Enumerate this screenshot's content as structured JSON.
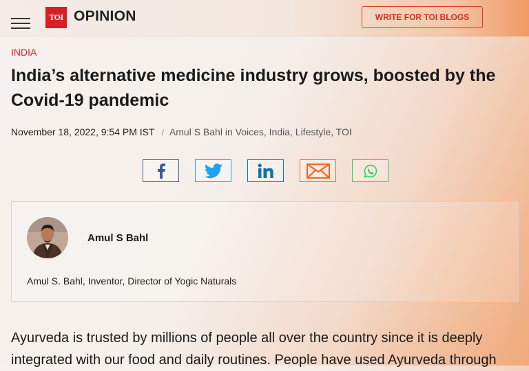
{
  "header": {
    "logo_text": "TOI",
    "section_title": "OPINION",
    "write_button": "WRITE FOR TOI BLOGS"
  },
  "article": {
    "category": "INDIA",
    "headline": "India’s alternative medicine industry grows, boosted by the Covid-19 pandemic",
    "datetime": "November 18, 2022, 9:54 PM IST",
    "separator": "/",
    "byline": "Amul S Bahl in Voices, India, Lifestyle, TOI",
    "body": "Ayurveda is trusted by millions of people all over the country since it is deeply integrated with our food and daily routines. People have used Ayurveda through"
  },
  "share": {
    "icons": [
      "facebook-icon",
      "twitter-icon",
      "linkedin-icon",
      "mail-icon",
      "whatsapp-icon"
    ],
    "colors": {
      "facebook": "#3b5998",
      "twitter": "#1da1f2",
      "linkedin": "#0e76a8",
      "mail": "#f26522",
      "whatsapp": "#25d366"
    }
  },
  "author": {
    "name": "Amul S Bahl",
    "bio": "Amul S. Bahl, Inventor, Director of Yogic Naturals"
  },
  "colors": {
    "brand_red": "#d71f25",
    "category_red": "#e02020",
    "button_red": "#e03a2b"
  }
}
